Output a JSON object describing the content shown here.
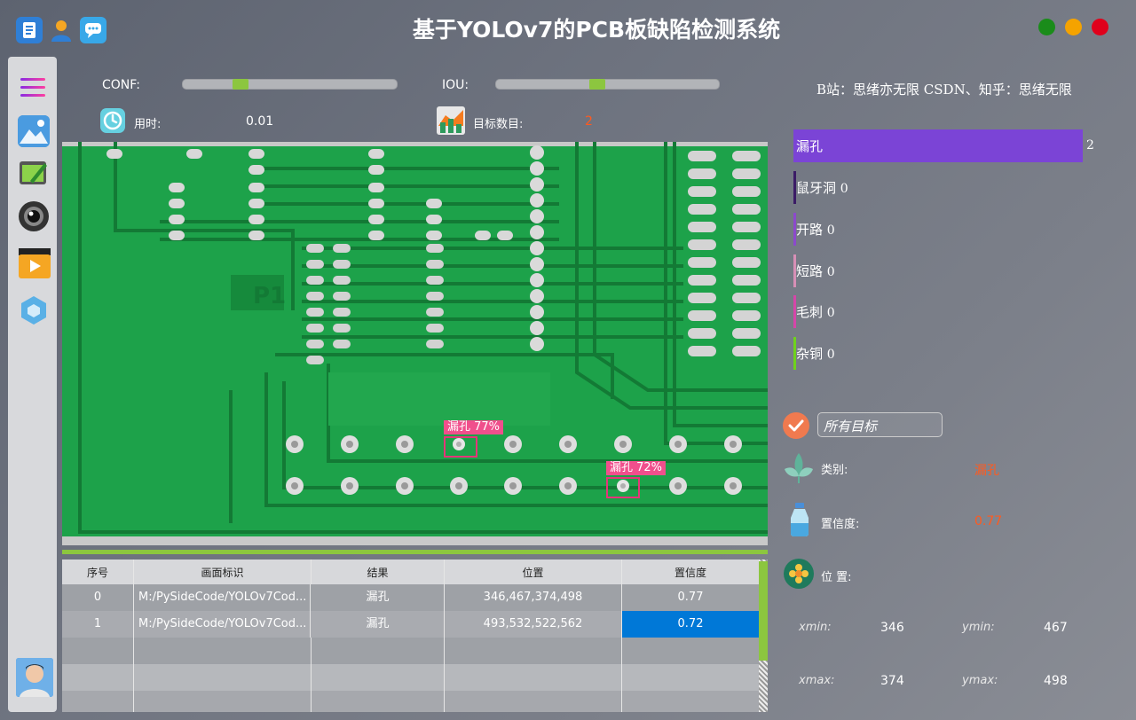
{
  "window": {
    "title": "基于YOLOv7的PCB板缺陷检测系统",
    "buttons": {
      "green": "#1a8c1a",
      "yellow": "#f5a300",
      "red": "#e0001b"
    }
  },
  "controls": {
    "conf_label": "CONF:",
    "conf_value": 0.25,
    "iou_label": "IOU:",
    "iou_value": 0.45,
    "time_label": "用时:",
    "time_value": "0.01",
    "count_label": "目标数目:",
    "count_value": "2"
  },
  "credit": "B站：思绪亦无限  CSDN、知乎：思绪无限",
  "detections_on_image": [
    {
      "label": "漏孔 77%"
    },
    {
      "label": "漏孔 72%"
    }
  ],
  "pcb_marking": "P1",
  "table": {
    "headers": [
      "序号",
      "画面标识",
      "结果",
      "位置",
      "置信度"
    ],
    "rows": [
      [
        "0",
        "M:/PySideCode/YOLOv7Cod...",
        "漏孔",
        "346,467,374,498",
        "0.77"
      ],
      [
        "1",
        "M:/PySideCode/YOLOv7Cod...",
        "漏孔",
        "493,532,522,562",
        "0.72"
      ]
    ],
    "selected_color": "#0078d7"
  },
  "class_counts": [
    {
      "name": "漏孔",
      "count": "2",
      "color": "#7b44d6"
    },
    {
      "name": "鼠牙洞",
      "count": "0",
      "color": "#3b1b66"
    },
    {
      "name": "开路",
      "count": "0",
      "color": "#8c49cc"
    },
    {
      "name": "短路",
      "count": "0",
      "color": "#d78fb6"
    },
    {
      "name": "毛刺",
      "count": "0",
      "color": "#d546a9"
    },
    {
      "name": "杂铜",
      "count": "0",
      "color": "#6fd21c"
    }
  ],
  "details": {
    "select_placeholder": "所有目标",
    "class_label": "类别:",
    "class_value": "漏孔",
    "conf_label": "置信度:",
    "conf_value": "0.77",
    "pos_label": "位 置:",
    "xmin_label": "xmin:",
    "xmin": "346",
    "ymin_label": "ymin:",
    "ymin": "467",
    "xmax_label": "xmax:",
    "xmax": "374",
    "ymax_label": "ymax:",
    "ymax": "498"
  }
}
